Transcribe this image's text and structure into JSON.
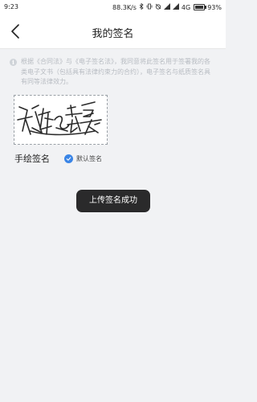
{
  "status_bar": {
    "time": "9:23",
    "network_speed": "88.3K/s",
    "network_type": "4G",
    "battery": "93%",
    "battery_level": 0.93,
    "icons": [
      "bluetooth-icon",
      "vibrate-icon",
      "alarm-off-icon",
      "signal-icon",
      "signal-icon",
      "battery-icon"
    ]
  },
  "nav": {
    "title": "我的签名",
    "back_icon": "chevron-left-icon"
  },
  "notice": {
    "icon": "info-icon",
    "text": "根据《合同法》与《电子签名法》，我同意将此签名用于签署我的各类电子文书（包括具有法律约束力的合约），电子签名与纸质签名具有同等法律效力。"
  },
  "signature": {
    "label": "手绘签名",
    "default_label": "默认签名",
    "default_checked": true,
    "accent_color": "#3a85e6"
  },
  "toast": {
    "text": "上传签名成功"
  }
}
